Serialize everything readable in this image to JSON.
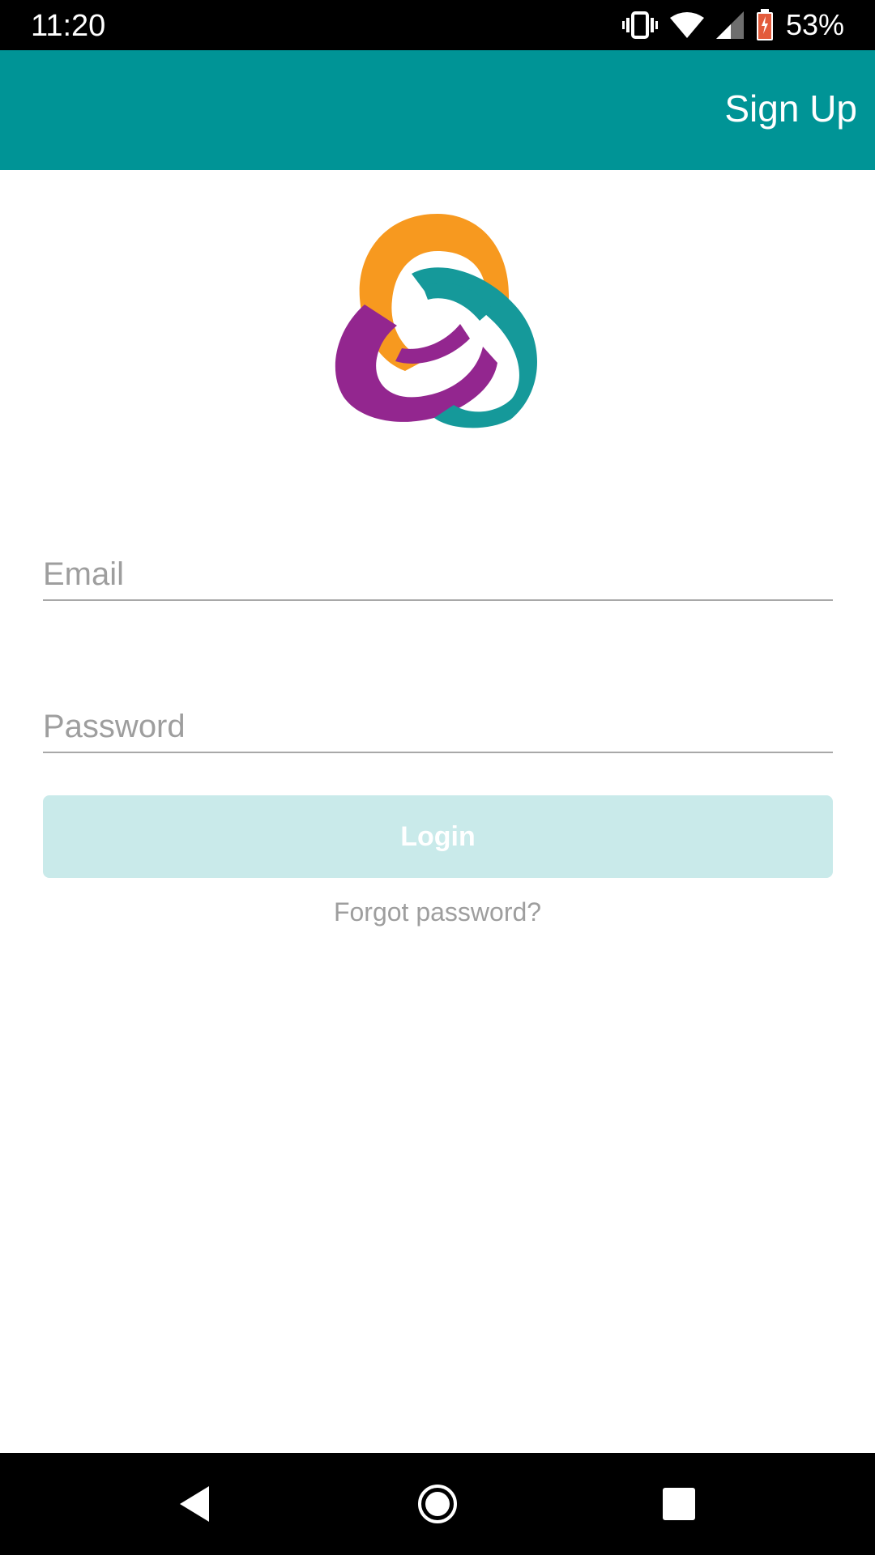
{
  "status_bar": {
    "time": "11:20",
    "battery_percent": "53%",
    "icons": [
      "vibrate-icon",
      "wifi-icon",
      "signal-icon",
      "battery-charging-icon"
    ]
  },
  "app_bar": {
    "background_color": "#009496",
    "signup_label": "Sign Up"
  },
  "logo": {
    "name": "three-interlocking-rings-logo",
    "colors": [
      "#F7991F",
      "#93268F",
      "#15999A"
    ]
  },
  "form": {
    "email_placeholder": "Email",
    "email_value": "",
    "password_placeholder": "Password",
    "password_value": "",
    "login_label": "Login",
    "login_color": "#C9EAEA",
    "forgot_label": "Forgot password?"
  },
  "nav_bar": {
    "icons": [
      "back-icon",
      "home-icon",
      "recents-icon"
    ]
  }
}
